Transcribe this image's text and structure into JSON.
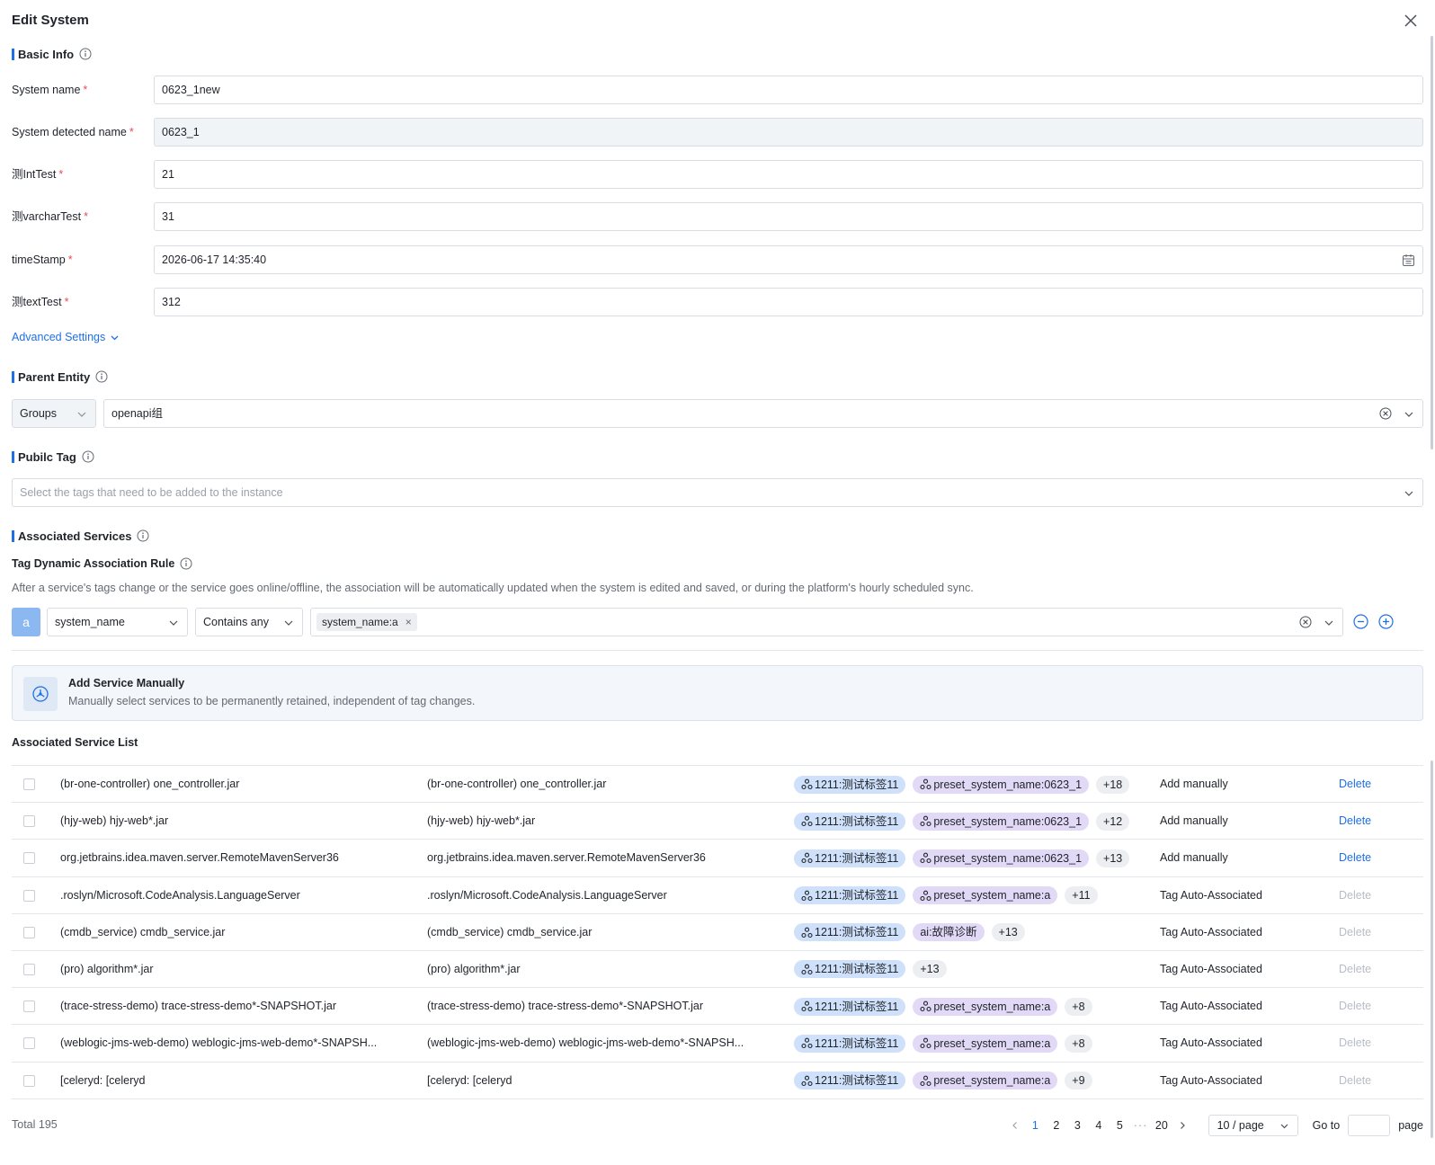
{
  "dialog": {
    "title": "Edit System"
  },
  "basic_info": {
    "heading": "Basic Info",
    "fields": [
      {
        "label": "System name",
        "value": "0623_1new"
      },
      {
        "label": "System detected name",
        "value": "0623_1"
      },
      {
        "label": "测IntTest",
        "value": "21"
      },
      {
        "label": "测varcharTest",
        "value": "31"
      },
      {
        "label": "timeStamp",
        "value": "2026-06-17 14:35:40"
      },
      {
        "label": "测textTest",
        "value": "312"
      }
    ],
    "required_mark": "*",
    "advanced_settings": "Advanced Settings"
  },
  "parent_entity": {
    "heading": "Parent Entity",
    "type": "Groups",
    "value": "openapi组"
  },
  "public_tag": {
    "heading": "Pubilc Tag",
    "placeholder": "Select the tags that need to be added to the instance"
  },
  "associated_services": {
    "heading": "Associated Services",
    "rule_title": "Tag Dynamic Association Rule",
    "rule_desc": "After a service's tags change or the service goes online/offline, the association will be automatically updated when the system is edited and saved, or during the platform's hourly scheduled sync.",
    "rule": {
      "letter": "a",
      "key": "system_name",
      "operator": "Contains any",
      "chip": "system_name:a",
      "chip_close": "×"
    },
    "manual": {
      "title": "Add Service Manually",
      "subtitle": "Manually select services to be permanently retained, independent of tag changes."
    },
    "list_title": "Associated Service List",
    "rows": [
      {
        "name": "(br-one-controller) one_controller.jar",
        "detected": "(br-one-controller) one_controller.jar",
        "tags": [
          {
            "text": "1211:测试标签11",
            "color": "blue",
            "icon": true
          },
          {
            "text": "preset_system_name:0623_1",
            "color": "purple",
            "icon": true
          },
          {
            "text": "+18",
            "color": "more",
            "icon": false
          }
        ],
        "source": "Add manually",
        "action": "Delete",
        "enabled": true
      },
      {
        "name": "(hjy-web) hjy-web*.jar",
        "detected": "(hjy-web) hjy-web*.jar",
        "tags": [
          {
            "text": "1211:测试标签11",
            "color": "blue",
            "icon": true
          },
          {
            "text": "preset_system_name:0623_1",
            "color": "purple",
            "icon": true
          },
          {
            "text": "+12",
            "color": "more",
            "icon": false
          }
        ],
        "source": "Add manually",
        "action": "Delete",
        "enabled": true
      },
      {
        "name": "org.jetbrains.idea.maven.server.RemoteMavenServer36",
        "detected": "org.jetbrains.idea.maven.server.RemoteMavenServer36",
        "tags": [
          {
            "text": "1211:测试标签11",
            "color": "blue",
            "icon": true
          },
          {
            "text": "preset_system_name:0623_1",
            "color": "purple",
            "icon": true
          },
          {
            "text": "+13",
            "color": "more",
            "icon": false
          }
        ],
        "source": "Add manually",
        "action": "Delete",
        "enabled": true
      },
      {
        "name": ".roslyn/Microsoft.CodeAnalysis.LanguageServer",
        "detected": ".roslyn/Microsoft.CodeAnalysis.LanguageServer",
        "tags": [
          {
            "text": "1211:测试标签11",
            "color": "blue",
            "icon": true
          },
          {
            "text": "preset_system_name:a",
            "color": "purple",
            "icon": true
          },
          {
            "text": "+11",
            "color": "more",
            "icon": false
          }
        ],
        "source": "Tag Auto-Associated",
        "action": "Delete",
        "enabled": false
      },
      {
        "name": "(cmdb_service) cmdb_service.jar",
        "detected": "(cmdb_service) cmdb_service.jar",
        "tags": [
          {
            "text": "1211:测试标签11",
            "color": "blue",
            "icon": true
          },
          {
            "text": "ai:故障诊断",
            "color": "purple",
            "icon": false
          },
          {
            "text": "+13",
            "color": "more",
            "icon": false
          }
        ],
        "source": "Tag Auto-Associated",
        "action": "Delete",
        "enabled": false
      },
      {
        "name": "(pro) algorithm*.jar",
        "detected": "(pro) algorithm*.jar",
        "tags": [
          {
            "text": "1211:测试标签11",
            "color": "blue",
            "icon": true
          },
          {
            "text": "+13",
            "color": "more",
            "icon": false
          }
        ],
        "source": "Tag Auto-Associated",
        "action": "Delete",
        "enabled": false
      },
      {
        "name": "(trace-stress-demo) trace-stress-demo*-SNAPSHOT.jar",
        "detected": "(trace-stress-demo) trace-stress-demo*-SNAPSHOT.jar",
        "tags": [
          {
            "text": "1211:测试标签11",
            "color": "blue",
            "icon": true
          },
          {
            "text": "preset_system_name:a",
            "color": "purple",
            "icon": true
          },
          {
            "text": "+8",
            "color": "more",
            "icon": false
          }
        ],
        "source": "Tag Auto-Associated",
        "action": "Delete",
        "enabled": false
      },
      {
        "name": "(weblogic-jms-web-demo) weblogic-jms-web-demo*-SNAPSH...",
        "detected": "(weblogic-jms-web-demo) weblogic-jms-web-demo*-SNAPSH...",
        "tags": [
          {
            "text": "1211:测试标签11",
            "color": "blue",
            "icon": true
          },
          {
            "text": "preset_system_name:a",
            "color": "purple",
            "icon": true
          },
          {
            "text": "+8",
            "color": "more",
            "icon": false
          }
        ],
        "source": "Tag Auto-Associated",
        "action": "Delete",
        "enabled": false
      },
      {
        "name": "[celeryd: [celeryd",
        "detected": "[celeryd: [celeryd",
        "tags": [
          {
            "text": "1211:测试标签11",
            "color": "blue",
            "icon": true
          },
          {
            "text": "preset_system_name:a",
            "color": "purple",
            "icon": true
          },
          {
            "text": "+9",
            "color": "more",
            "icon": false
          }
        ],
        "source": "Tag Auto-Associated",
        "action": "Delete",
        "enabled": false
      }
    ]
  },
  "pagination": {
    "total": "Total 195",
    "pages": [
      "1",
      "2",
      "3",
      "4",
      "5"
    ],
    "ellipsis": "···",
    "last_page": "20",
    "current": "1",
    "per_page": "10 / page",
    "goto_label": "Go to",
    "page_label": "page"
  },
  "colors": {
    "accent": "#1f6fe5",
    "required": "#e34d59",
    "tag_blue": "#cfe0fa",
    "tag_purple": "#e2d9f7"
  }
}
